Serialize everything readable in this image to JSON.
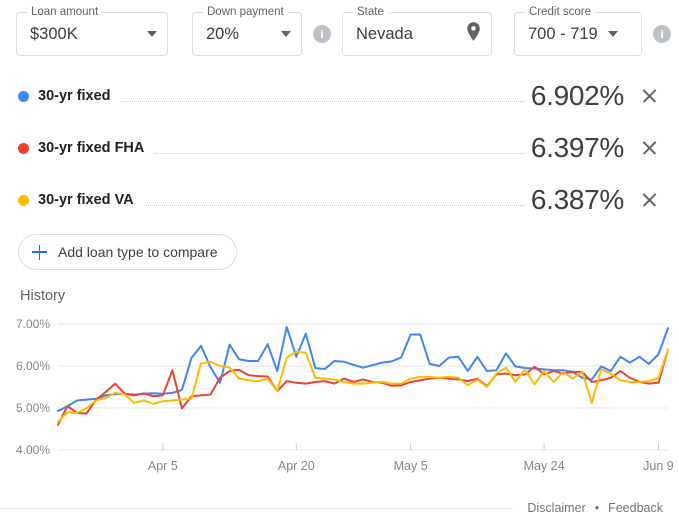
{
  "filters": [
    {
      "id": "loan-amount",
      "label": "Loan amount",
      "value": "$300K",
      "control": "dropdown-caret",
      "info": false
    },
    {
      "id": "down-payment",
      "label": "Down payment",
      "value": "20%",
      "control": "dropdown-caret",
      "info": true,
      "info_icon": "info-icon"
    },
    {
      "id": "state",
      "label": "State",
      "value": "Nevada",
      "control": "location-pin",
      "info": false
    },
    {
      "id": "credit-score",
      "label": "Credit score",
      "value": "700 - 719",
      "control": "dropdown-caret",
      "info": true,
      "info_icon": "info-icon"
    }
  ],
  "rates": [
    {
      "name": "30-yr fixed",
      "value": "6.902%",
      "color": "#4285F4",
      "close_icon": "close-icon"
    },
    {
      "name": "30-yr fixed FHA",
      "value": "6.397%",
      "color": "#EA4335",
      "close_icon": "close-icon"
    },
    {
      "name": "30-yr fixed VA",
      "value": "6.387%",
      "color": "#FBBC04",
      "close_icon": "close-icon"
    }
  ],
  "add_button": {
    "label": "Add loan type to compare",
    "icon": "plus-icon",
    "icon_color": "#1a73e8"
  },
  "history": {
    "title": "History"
  },
  "footer": {
    "disclaimer": "Disclaimer",
    "separator": "•",
    "feedback": "Feedback"
  },
  "chart_data": {
    "type": "line",
    "title": "History",
    "xlabel": "",
    "ylabel": "",
    "ylim": [
      4.0,
      7.0
    ],
    "ytick_labels": [
      "7.00%",
      "6.00%",
      "5.00%",
      "4.00%"
    ],
    "yticks": [
      7.0,
      6.0,
      5.0,
      4.0
    ],
    "xtick_labels": [
      "Apr 5",
      "Apr 20",
      "May 5",
      "May 24",
      "Jun 9"
    ],
    "xtick_indices": [
      11,
      25,
      37,
      51,
      63
    ],
    "grid": "horizontal",
    "legend_position": "above-chart",
    "n_points": 65,
    "series": [
      {
        "name": "30-yr fixed",
        "color": "#4285F4",
        "values": [
          4.93,
          5.04,
          5.18,
          5.2,
          5.22,
          5.3,
          5.33,
          5.33,
          5.32,
          5.34,
          5.35,
          5.34,
          5.36,
          5.43,
          6.19,
          6.48,
          5.97,
          5.6,
          6.51,
          6.16,
          6.12,
          6.12,
          6.52,
          5.88,
          6.93,
          6.22,
          6.77,
          5.95,
          5.93,
          6.12,
          6.1,
          6.03,
          5.96,
          6.02,
          6.08,
          6.11,
          6.2,
          6.75,
          6.75,
          6.05,
          6.0,
          6.2,
          6.22,
          5.88,
          6.22,
          5.88,
          5.9,
          6.3,
          5.99,
          5.95,
          5.94,
          5.92,
          5.9,
          5.9,
          5.86,
          5.72,
          5.68,
          5.99,
          5.88,
          6.22,
          6.08,
          6.22,
          6.05,
          6.28,
          6.9
        ]
      },
      {
        "name": "30-yr fixed FHA",
        "color": "#EA4335",
        "values": [
          4.6,
          5.05,
          4.88,
          4.87,
          5.2,
          5.38,
          5.58,
          5.34,
          5.3,
          5.35,
          5.28,
          5.3,
          5.9,
          4.99,
          5.28,
          5.3,
          5.32,
          5.72,
          5.88,
          5.91,
          5.78,
          5.76,
          5.75,
          5.4,
          5.64,
          5.6,
          5.58,
          5.62,
          5.64,
          5.58,
          5.7,
          5.62,
          5.68,
          5.62,
          5.6,
          5.53,
          5.54,
          5.62,
          5.66,
          5.7,
          5.72,
          5.7,
          5.68,
          5.64,
          5.7,
          5.52,
          5.8,
          5.82,
          5.78,
          5.8,
          5.98,
          5.8,
          5.88,
          5.82,
          5.86,
          5.86,
          5.62,
          5.66,
          5.72,
          5.88,
          5.72,
          5.62,
          5.58,
          5.6,
          6.39
        ]
      },
      {
        "name": "30-yr fixed VA",
        "color": "#FBBC04",
        "values": [
          4.67,
          4.9,
          4.88,
          5.0,
          5.18,
          5.24,
          5.36,
          5.32,
          5.12,
          5.18,
          5.1,
          5.16,
          5.18,
          5.2,
          5.22,
          6.06,
          6.1,
          6.0,
          5.96,
          5.7,
          5.66,
          5.64,
          5.7,
          5.4,
          6.2,
          6.34,
          6.32,
          5.72,
          5.7,
          5.68,
          5.62,
          5.58,
          5.58,
          5.6,
          5.62,
          5.58,
          5.58,
          5.7,
          5.74,
          5.74,
          5.72,
          5.74,
          5.72,
          5.54,
          5.68,
          5.5,
          5.82,
          5.96,
          5.62,
          5.92,
          5.56,
          5.88,
          5.62,
          5.86,
          5.7,
          5.86,
          5.12,
          5.92,
          5.82,
          5.66,
          5.62,
          5.62,
          5.64,
          5.72,
          6.39
        ]
      }
    ]
  }
}
